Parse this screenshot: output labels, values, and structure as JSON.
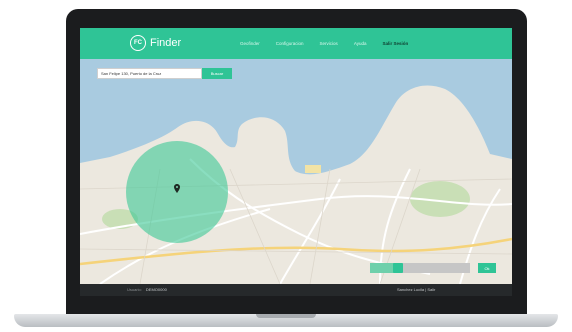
{
  "brand": {
    "logo_initials": "FC",
    "name": "Finder"
  },
  "nav": {
    "items": [
      {
        "label": "Geofinder",
        "active": false
      },
      {
        "label": "Configuracion",
        "active": false
      },
      {
        "label": "Servicios",
        "active": false
      },
      {
        "label": "Ayuda",
        "active": false
      },
      {
        "label": "Salir Sesión",
        "active": true
      }
    ]
  },
  "search": {
    "value": "San Felipe 130, Puerto de la Cruz",
    "button_label": "Buscar"
  },
  "radius": {
    "level": 0.28,
    "button_label": "Ok"
  },
  "footer": {
    "left_label": "Usuario:",
    "left_value": "DEMO0000",
    "right": "Sanchez Lucila  |  Salir"
  },
  "colors": {
    "accent": "#2fc496",
    "bezel": "#1b1c1e",
    "footer_bg": "#26292b"
  }
}
